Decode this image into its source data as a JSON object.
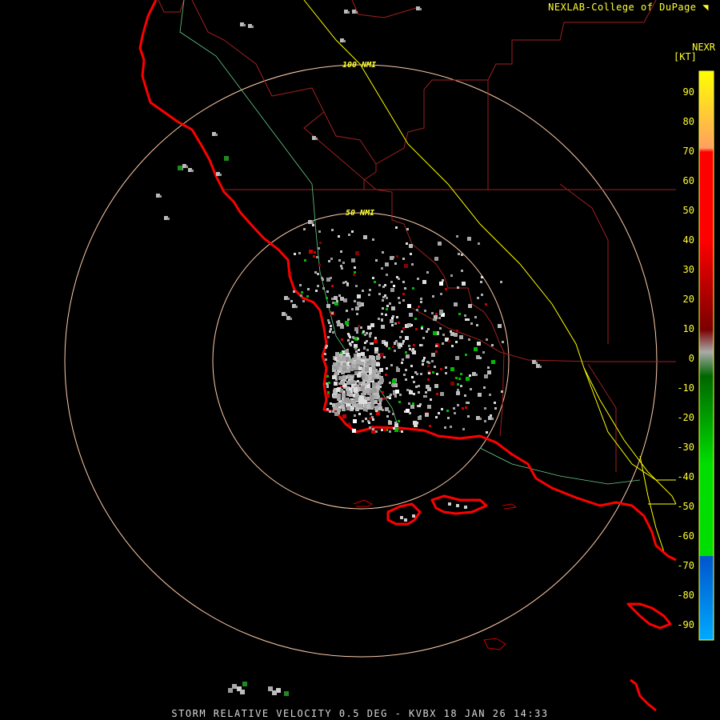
{
  "header": {
    "source": "NEXLAB-College of DuPage",
    "logo_icon": "cod-logo-icon",
    "product_code": "NEXR",
    "units": "[KT]"
  },
  "footer": {
    "caption": "STORM RELATIVE VELOCITY 0.5 DEG - KVBX 18 JAN 26 14:33"
  },
  "range_rings": [
    {
      "label": "100 NMI",
      "range_nmi": 100
    },
    {
      "label": "50 NMI",
      "range_nmi": 50
    }
  ],
  "legend": {
    "ticks": [
      "90",
      "80",
      "70",
      "60",
      "50",
      "40",
      "30",
      "20",
      "10",
      "0",
      "-10",
      "-20",
      "-30",
      "-40",
      "-50",
      "-60",
      "-70",
      "-80",
      "-90"
    ],
    "colors": {
      "yellow": "#ffff00",
      "orange": "#ffa060",
      "red": "#ff0000",
      "dark_red": "#7a0000",
      "gray": "#aaaaaa",
      "dark_green": "#006600",
      "green": "#00dd00",
      "blue": "#0055cc",
      "light_blue": "#00aaff"
    }
  },
  "colors": {
    "coastline": "#ff0000",
    "county_lines": "#a02020",
    "highways": "#ffff00",
    "rivers": "#66cc88",
    "range_ring": "#ffccaa",
    "background": "#000000"
  }
}
